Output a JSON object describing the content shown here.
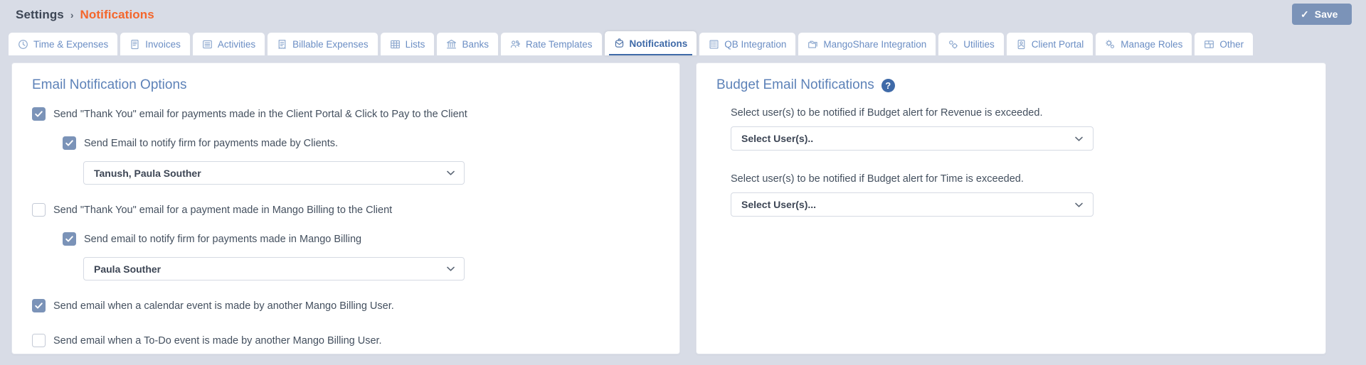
{
  "breadcrumb": {
    "root": "Settings",
    "separator": "›",
    "current": "Notifications"
  },
  "toolbar": {
    "save_label": "Save",
    "save_icon": "check-icon",
    "save_color": "#7b93b8"
  },
  "tabs": [
    {
      "label": "Time & Expenses",
      "icon": "clock-icon",
      "active": false
    },
    {
      "label": "Invoices",
      "icon": "invoice-icon",
      "active": false
    },
    {
      "label": "Activities",
      "icon": "list-icon",
      "active": false
    },
    {
      "label": "Billable Expenses",
      "icon": "receipt-icon",
      "active": false
    },
    {
      "label": "Lists",
      "icon": "table-icon",
      "active": false
    },
    {
      "label": "Banks",
      "icon": "bank-icon",
      "active": false
    },
    {
      "label": "Rate Templates",
      "icon": "people-icon",
      "active": false
    },
    {
      "label": "Notifications",
      "icon": "bell-mail-icon",
      "active": true
    },
    {
      "label": "QB Integration",
      "icon": "grid-dots-icon",
      "active": false
    },
    {
      "label": "MangoShare Integration",
      "icon": "folders-icon",
      "active": false
    },
    {
      "label": "Utilities",
      "icon": "gears-small-icon",
      "active": false
    },
    {
      "label": "Client Portal",
      "icon": "id-card-icon",
      "active": false
    },
    {
      "label": "Manage Roles",
      "icon": "gears-icon",
      "active": false
    },
    {
      "label": "Other",
      "icon": "layout-icon",
      "active": false
    }
  ],
  "left_panel": {
    "title": "Email Notification Options",
    "options": [
      {
        "label": "Send \"Thank You\" email for payments made in the Client Portal & Click to Pay to the Client",
        "checked": true,
        "indent": false
      },
      {
        "label": "Send Email to notify firm for payments made by Clients.",
        "checked": true,
        "indent": true
      },
      {
        "label": "Send \"Thank You\" email for a payment made in Mango Billing to the Client",
        "checked": false,
        "indent": false
      },
      {
        "label": "Send email to notify firm for payments made in Mango Billing",
        "checked": true,
        "indent": true
      },
      {
        "label": "Send email when a calendar event is made by another Mango Billing User.",
        "checked": true,
        "indent": false
      },
      {
        "label": "Send email when a To-Do event is made by another Mango Billing User.",
        "checked": false,
        "indent": false
      }
    ],
    "select_client_portal_users": "Tanush, Paula Souther",
    "select_mango_billing_users": "Paula Souther"
  },
  "right_panel": {
    "title": "Budget Email Notifications",
    "help_icon": "question-mark-icon",
    "help_glyph": "?",
    "revenue": {
      "label": "Select user(s) to be notified if Budget alert for Revenue is exceeded.",
      "value": "Select User(s).."
    },
    "time": {
      "label": "Select user(s) to be notified if Budget alert for Time is exceeded.",
      "value": "Select User(s)..."
    }
  },
  "colors": {
    "accent_orange": "#f4662b",
    "heading_blue": "#5d82b8",
    "tab_blue": "#6b8ec4",
    "checkbox_on": "#7b93b8",
    "page_bg": "#d8dce6"
  }
}
